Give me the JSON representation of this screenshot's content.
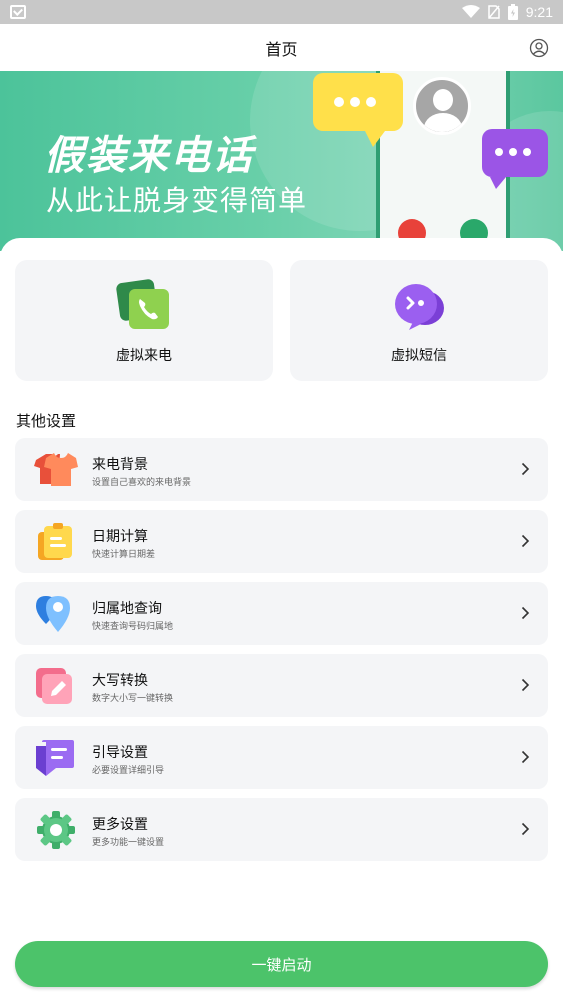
{
  "status_bar": {
    "time": "9:21",
    "icons": [
      "notification-mailbox-icon",
      "wifi-icon",
      "no-sim-icon",
      "battery-icon"
    ]
  },
  "header": {
    "title": "首页",
    "profile_icon": "user-profile-icon"
  },
  "banner": {
    "title": "假装来电话",
    "subtitle": "从此让脱身变得简单"
  },
  "feature_cards": [
    {
      "label": "虚拟来电",
      "icon": "phone-call-icon"
    },
    {
      "label": "虚拟短信",
      "icon": "chat-message-icon"
    }
  ],
  "other_settings": {
    "title": "其他设置",
    "items": [
      {
        "title": "来电背景",
        "subtitle": "设置自己喜欢的来电背景",
        "icon": "tshirt-icon"
      },
      {
        "title": "日期计算",
        "subtitle": "快速计算日期差",
        "icon": "clipboard-icon"
      },
      {
        "title": "归属地查询",
        "subtitle": "快速查询号码归属地",
        "icon": "location-pin-icon"
      },
      {
        "title": "大写转换",
        "subtitle": "数字大小写一键转换",
        "icon": "edit-pen-icon"
      },
      {
        "title": "引导设置",
        "subtitle": "必要设置详细引导",
        "icon": "guide-icon"
      },
      {
        "title": "更多设置",
        "subtitle": "更多功能一键设置",
        "icon": "gear-icon"
      }
    ]
  },
  "start_button": {
    "label": "一键启动"
  },
  "colors": {
    "accent_green": "#4cc36a",
    "banner_green": "#5bc79f",
    "card_bg": "#f4f5f7"
  }
}
